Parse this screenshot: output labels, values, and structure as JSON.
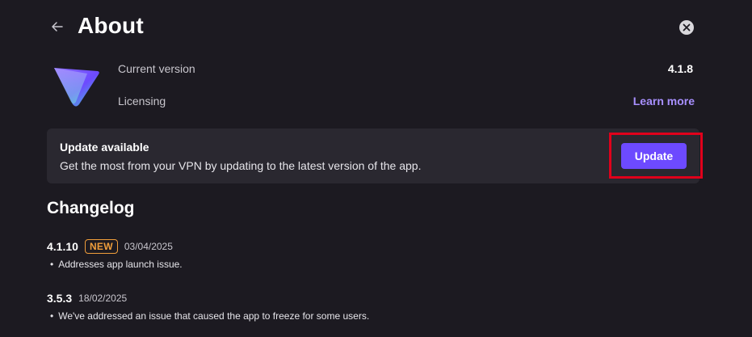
{
  "header": {
    "title": "About"
  },
  "app_info": {
    "current_version_label": "Current version",
    "current_version_value": "4.1.8",
    "licensing_label": "Licensing",
    "learn_more_label": "Learn more"
  },
  "update_card": {
    "title": "Update available",
    "description": "Get the most from your VPN by updating to the latest version of the app.",
    "button_label": "Update"
  },
  "changelog": {
    "heading": "Changelog",
    "entries": [
      {
        "version": "4.1.10",
        "badge": "NEW",
        "date": "03/04/2025",
        "note": "Addresses app launch issue."
      },
      {
        "version": "3.5.3",
        "date": "18/02/2025",
        "note": "We've addressed an issue that caused the app to freeze for some users."
      }
    ]
  },
  "colors": {
    "background": "#1c1a21",
    "card": "#2a2830",
    "accent": "#6d4aff",
    "link": "#a890ff",
    "badge": "#f09e3b",
    "highlight": "#e0001b"
  },
  "icons": {
    "back": "arrow-left-icon",
    "close": "close-icon",
    "logo": "proton-vpn-logo"
  }
}
